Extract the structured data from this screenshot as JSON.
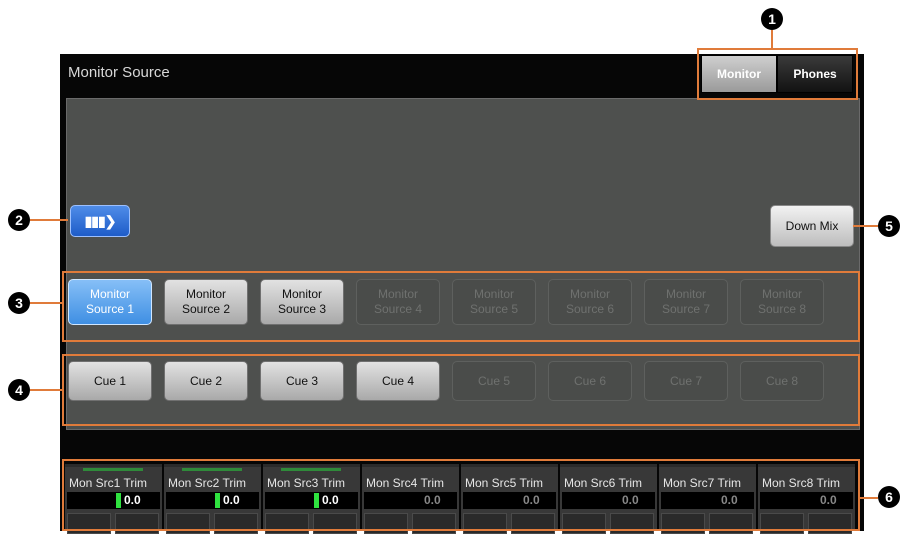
{
  "header": {
    "title": "Monitor Source"
  },
  "mode_toggle": {
    "monitor": "Monitor",
    "phones": "Phones",
    "selected": "Monitor"
  },
  "meter_button": {
    "icon": "signal-bars-icon"
  },
  "downmix": {
    "label": "Down Mix"
  },
  "monitor_sources": [
    {
      "label": "Monitor\nSource 1",
      "state": "active"
    },
    {
      "label": "Monitor\nSource 2",
      "state": "enabled"
    },
    {
      "label": "Monitor\nSource 3",
      "state": "enabled"
    },
    {
      "label": "Monitor\nSource 4",
      "state": "disabled"
    },
    {
      "label": "Monitor\nSource 5",
      "state": "disabled"
    },
    {
      "label": "Monitor\nSource 6",
      "state": "disabled"
    },
    {
      "label": "Monitor\nSource 7",
      "state": "disabled"
    },
    {
      "label": "Monitor\nSource 8",
      "state": "disabled"
    }
  ],
  "cues": [
    {
      "label": "Cue 1",
      "state": "enabled"
    },
    {
      "label": "Cue 2",
      "state": "enabled"
    },
    {
      "label": "Cue 3",
      "state": "enabled"
    },
    {
      "label": "Cue 4",
      "state": "enabled"
    },
    {
      "label": "Cue 5",
      "state": "disabled"
    },
    {
      "label": "Cue 6",
      "state": "disabled"
    },
    {
      "label": "Cue 7",
      "state": "disabled"
    },
    {
      "label": "Cue 8",
      "state": "disabled"
    }
  ],
  "trims": [
    {
      "label": "Mon Src1 Trim",
      "value": "0.0",
      "active": true
    },
    {
      "label": "Mon Src2 Trim",
      "value": "0.0",
      "active": true
    },
    {
      "label": "Mon Src3 Trim",
      "value": "0.0",
      "active": true
    },
    {
      "label": "Mon Src4 Trim",
      "value": "0.0",
      "active": false
    },
    {
      "label": "Mon Src5 Trim",
      "value": "0.0",
      "active": false
    },
    {
      "label": "Mon Src6 Trim",
      "value": "0.0",
      "active": false
    },
    {
      "label": "Mon Src7 Trim",
      "value": "0.0",
      "active": false
    },
    {
      "label": "Mon Src8 Trim",
      "value": "0.0",
      "active": false
    }
  ],
  "callouts": [
    "1",
    "2",
    "3",
    "4",
    "5",
    "6"
  ],
  "colors": {
    "callout": "#e07b3a",
    "active_button": "#3f8fe3",
    "meter_green": "#2fe23f"
  }
}
